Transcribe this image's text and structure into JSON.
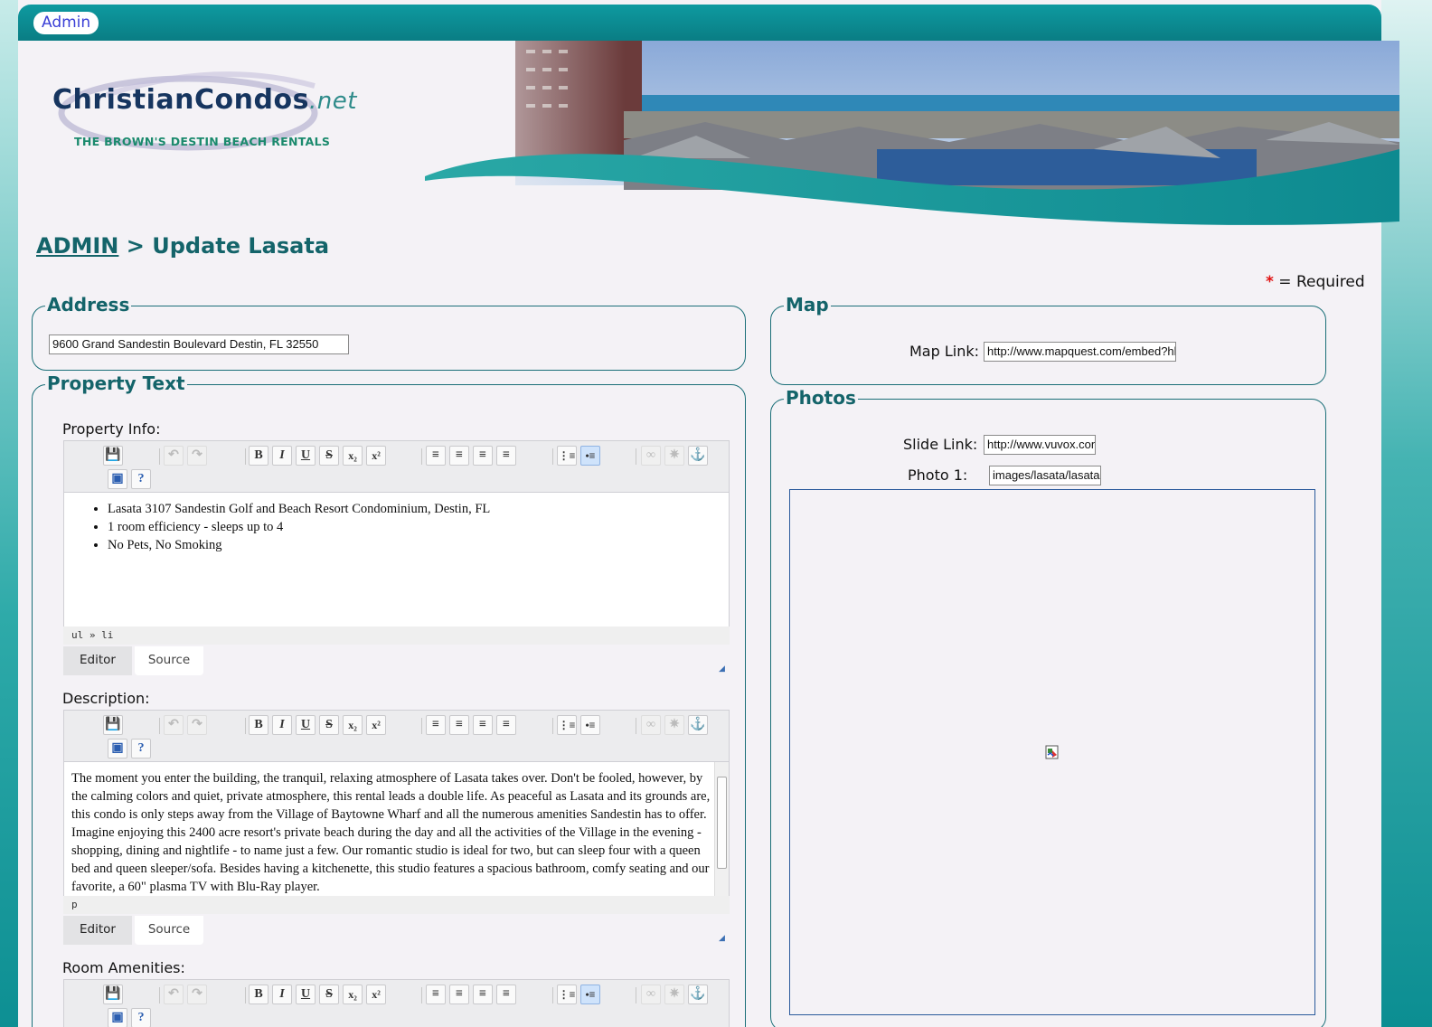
{
  "topbar": {
    "admin_label": "Admin"
  },
  "logo": {
    "title": "ChristianCondos",
    "tld": ".net",
    "tagline": "THE BROWN'S DESTIN BEACH RENTALS"
  },
  "breadcrumb": {
    "root": "ADMIN",
    "separator": ">",
    "current": "Update Lasata"
  },
  "required_note": {
    "star": "*",
    "text": "= Required"
  },
  "address": {
    "legend": "Address",
    "value": "9600 Grand Sandestin Boulevard  Destin, FL 32550"
  },
  "map": {
    "legend": "Map",
    "link_label": "Map Link:",
    "link_value": "http://www.mapquest.com/embed?hl"
  },
  "photos": {
    "legend": "Photos",
    "slide_label": "Slide Link:",
    "slide_value": "http://www.vuvox.con",
    "photo1_label": "Photo 1:",
    "photo1_value": "images/lasata/lasata"
  },
  "property_text": {
    "legend": "Property Text",
    "property_info": {
      "label": "Property Info:",
      "items": [
        "Lasata 3107 Sandestin Golf and Beach Resort Condominium, Destin, FL",
        "1 room efficiency - sleeps up to 4",
        "No Pets, No Smoking"
      ],
      "path": "ul » li"
    },
    "description": {
      "label": "Description:",
      "text": "The moment you enter the building, the tranquil, relaxing atmosphere of Lasata takes over. Don't be fooled, however, by the calming colors and quiet, private atmosphere, this rental leads a double life. As peaceful as Lasata and its grounds are, this condo is only steps away from the Village of Baytowne Wharf and all the numerous amenities Sandestin has to offer. Imagine enjoying this 2400 acre resort's private beach during the day and all the activities of the Village in the evening - shopping, dining and nightlife - to name just a few. Our romantic studio is ideal for two, but can sleep four with a queen bed and queen sleeper/sofa. Besides having a kitchenette, this studio features a spacious bathroom, comfy seating and our favorite, a 60\" plasma TV with Blu-Ray player.",
      "path": "p"
    },
    "room_amenities": {
      "label": "Room Amenities:"
    }
  },
  "editor_tabs": {
    "editor": "Editor",
    "source": "Source"
  },
  "toolbar_glyphs": {
    "bold": "B",
    "italic": "I",
    "underline": "U",
    "strike": "S",
    "subscript": "x₂",
    "superscript": "x²"
  }
}
